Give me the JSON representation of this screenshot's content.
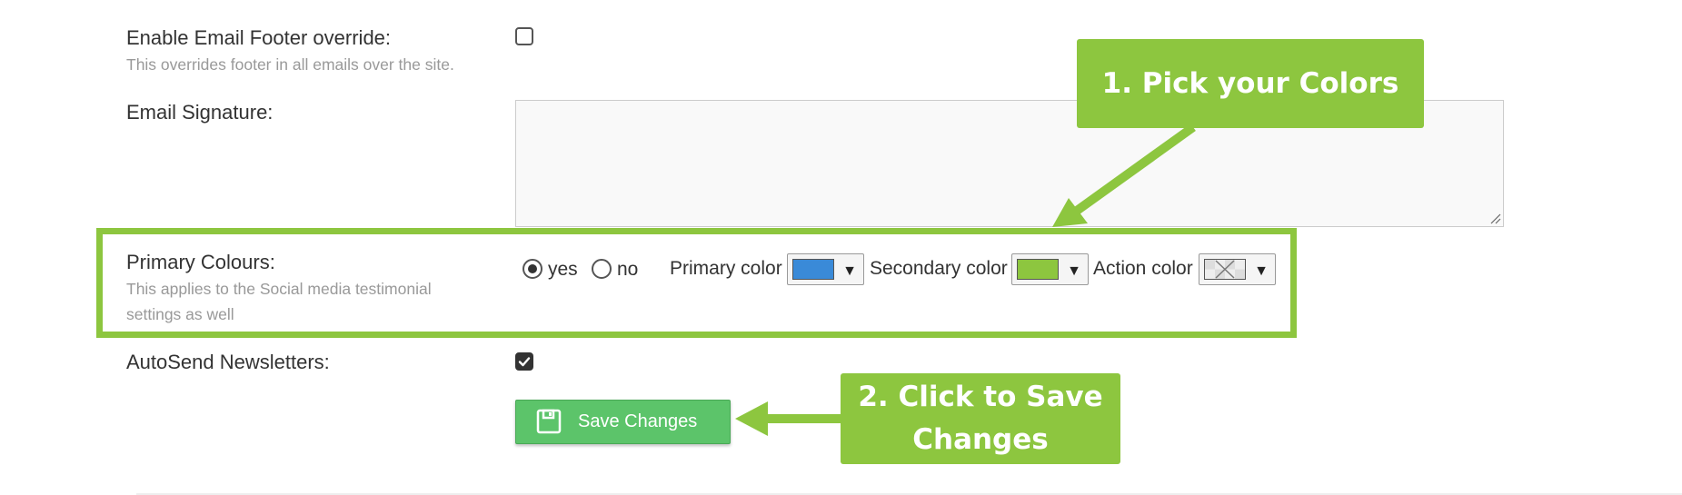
{
  "footer_override": {
    "label": "Enable Email Footer override:",
    "hint": "This overrides footer in all emails over the site.",
    "checked": false
  },
  "email_signature": {
    "label": "Email Signature:",
    "value": ""
  },
  "primary_colours": {
    "label": "Primary Colours:",
    "hint": "This applies to the Social media testimonial settings as well",
    "options": [
      {
        "label": "yes",
        "selected": true
      },
      {
        "label": "no",
        "selected": false
      }
    ],
    "primary_color": {
      "label": "Primary color",
      "value": "#3a8ad8"
    },
    "secondary_color": {
      "label": "Secondary color",
      "value": "#8dc63f"
    },
    "action_color": {
      "label": "Action color",
      "value": "none"
    }
  },
  "autosend": {
    "label": "AutoSend Newsletters:",
    "checked": true
  },
  "save_button": {
    "label": "Save Changes",
    "icon": "floppy-disk-icon"
  },
  "callouts": {
    "pick_colors": "1. Pick your Colors",
    "click_save": "2. Click to Save Changes",
    "color": "#8dc63f"
  }
}
